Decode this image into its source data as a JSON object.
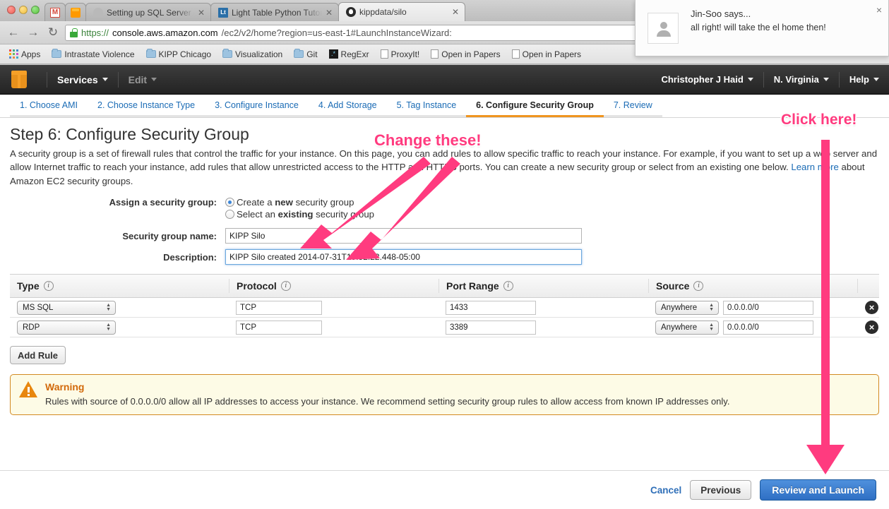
{
  "browser": {
    "tabs": [
      {
        "title": "",
        "favicon": "gmail-icon",
        "pinned": true,
        "active": false
      },
      {
        "title": "",
        "favicon": "aws-cube-icon",
        "pinned": true,
        "active": false
      },
      {
        "title": "Setting up SQL Server on A",
        "favicon": "generic-page-icon",
        "pinned": false,
        "active": false
      },
      {
        "title": "Light Table Python Tutoria",
        "favicon": "light-table-icon",
        "pinned": false,
        "active": false
      },
      {
        "title": "kippdata/silo",
        "favicon": "github-icon",
        "pinned": false,
        "active": true
      }
    ],
    "nav": {
      "back": "←",
      "forward": "→",
      "reload": "C"
    },
    "url": {
      "scheme": "https://",
      "host": "console.aws.amazon.com",
      "path": "/ec2/v2/home?region=us-east-1#LaunchInstanceWizard:",
      "secure_label": "lock-icon"
    },
    "bookmarks": [
      {
        "label": "Apps",
        "icon": "apps-grid-icon"
      },
      {
        "label": "Intrastate Violence",
        "icon": "folder-icon"
      },
      {
        "label": "KIPP Chicago",
        "icon": "folder-icon"
      },
      {
        "label": "Visualization",
        "icon": "folder-icon"
      },
      {
        "label": "Git",
        "icon": "folder-icon"
      },
      {
        "label": "RegExr",
        "icon": "regexr-icon"
      },
      {
        "label": "ProxyIt!",
        "icon": "page-icon"
      },
      {
        "label": "Open in Papers",
        "icon": "page-icon"
      },
      {
        "label": "Open in Papers",
        "icon": "page-icon"
      }
    ]
  },
  "notification": {
    "title": "Jin-Soo says...",
    "message": "all right! will take the el home then!",
    "close": "×"
  },
  "aws_header": {
    "logo": "aws-cube-logo",
    "services": "Services",
    "edit": "Edit",
    "account": "Christopher J Haid",
    "region": "N. Virginia",
    "help": "Help"
  },
  "wizard_tabs": [
    {
      "label": "1. Choose AMI",
      "active": false
    },
    {
      "label": "2. Choose Instance Type",
      "active": false
    },
    {
      "label": "3. Configure Instance",
      "active": false
    },
    {
      "label": "4. Add Storage",
      "active": false
    },
    {
      "label": "5. Tag Instance",
      "active": false
    },
    {
      "label": "6. Configure Security Group",
      "active": true
    },
    {
      "label": "7. Review",
      "active": false
    }
  ],
  "page": {
    "title": "Step 6: Configure Security Group",
    "desc_part1": "A security group is a set of firewall rules that control the traffic for your instance. On this page, you can add rules to allow specific traffic to reach your instance. For example, if you want to set up a web server and allow Internet traffic to reach your instance, add rules that allow unrestricted access to the HTTP and HTTPS ports. You can create a new security group or select from an existing one below. ",
    "learn_more": "Learn more",
    "desc_part2": " about Amazon EC2 security groups."
  },
  "form": {
    "assign_label": "Assign a security group:",
    "option_new_prefix": "Create a ",
    "option_new_bold": "new",
    "option_new_suffix": " security group",
    "option_existing_prefix": "Select an ",
    "option_existing_bold": "existing",
    "option_existing_suffix": " security group",
    "selected": "new",
    "name_label": "Security group name:",
    "name_value": "KIPP Silo",
    "desc_label": "Description:",
    "desc_value": "KIPP Silo created 2014-07-31T15:52:22.448-05:00"
  },
  "rules_table": {
    "headers": [
      "Type",
      "Protocol",
      "Port Range",
      "Source"
    ],
    "info_glyph": "i",
    "rows": [
      {
        "type": "MS SQL",
        "protocol": "TCP",
        "port_range": "1433",
        "source_select": "Anywhere",
        "source_value": "0.0.0.0/0",
        "delete": "×"
      },
      {
        "type": "RDP",
        "protocol": "TCP",
        "port_range": "3389",
        "source_select": "Anywhere",
        "source_value": "0.0.0.0/0",
        "delete": "×"
      }
    ],
    "add_rule": "Add Rule"
  },
  "warning": {
    "icon": "warning-triangle-icon",
    "title": "Warning",
    "text": "Rules with source of 0.0.0.0/0 allow all IP addresses to access your instance. We recommend setting security group rules to allow access from known IP addresses only."
  },
  "footer": {
    "cancel": "Cancel",
    "previous": "Previous",
    "review_and_launch": "Review and Launch"
  },
  "annotations": {
    "change_these": "Change these!",
    "click_here": "Click here!",
    "color": "#ff3b7f"
  }
}
